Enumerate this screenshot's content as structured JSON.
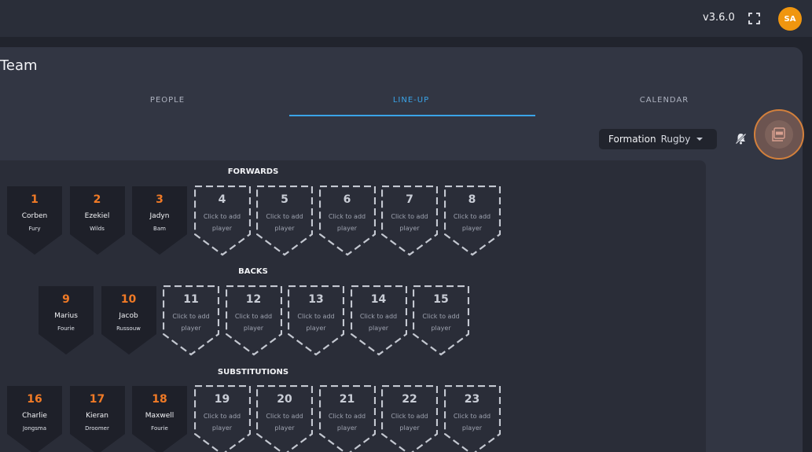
{
  "header": {
    "version": "v3.6.0",
    "avatar_initials": "SA",
    "fullscreen_icon": "fullscreen-icon"
  },
  "page": {
    "title": "Team"
  },
  "tabs": [
    {
      "label": "PEOPLE",
      "active": false
    },
    {
      "label": "LINE-UP",
      "active": true
    },
    {
      "label": "CALENDAR",
      "active": false
    }
  ],
  "toolbar": {
    "formation_label": "Formation",
    "formation_value": "Rugby",
    "bell_icon": "bell-mute-icon",
    "pdf_icon": "pdf-icon"
  },
  "colors": {
    "accent": "#3aa4e8",
    "number_filled": "#f07a26",
    "avatar": "#f0960f"
  },
  "lineup": {
    "add_line1": "Click to add",
    "add_line2": "player",
    "sections": [
      {
        "title": "FORWARDS",
        "slots": [
          {
            "number": "1",
            "first": "Corben",
            "last": "Fury"
          },
          {
            "number": "2",
            "first": "Ezekiel",
            "last": "Wilds"
          },
          {
            "number": "3",
            "first": "Jadyn",
            "last": "Bam"
          },
          {
            "number": "4"
          },
          {
            "number": "5"
          },
          {
            "number": "6"
          },
          {
            "number": "7"
          },
          {
            "number": "8"
          }
        ]
      },
      {
        "title": "BACKS",
        "slots": [
          {
            "number": "9",
            "first": "Marius",
            "last": "Fourie"
          },
          {
            "number": "10",
            "first": "Jacob",
            "last": "Russouw"
          },
          {
            "number": "11"
          },
          {
            "number": "12"
          },
          {
            "number": "13"
          },
          {
            "number": "14"
          },
          {
            "number": "15"
          }
        ]
      },
      {
        "title": "SUBSTITUTIONS",
        "slots": [
          {
            "number": "16",
            "first": "Charlie",
            "last": "Jongsma"
          },
          {
            "number": "17",
            "first": "Kieran",
            "last": "Droomer"
          },
          {
            "number": "18",
            "first": "Maxwell",
            "last": "Fourie"
          },
          {
            "number": "19"
          },
          {
            "number": "20"
          },
          {
            "number": "21"
          },
          {
            "number": "22"
          },
          {
            "number": "23"
          }
        ]
      }
    ]
  }
}
